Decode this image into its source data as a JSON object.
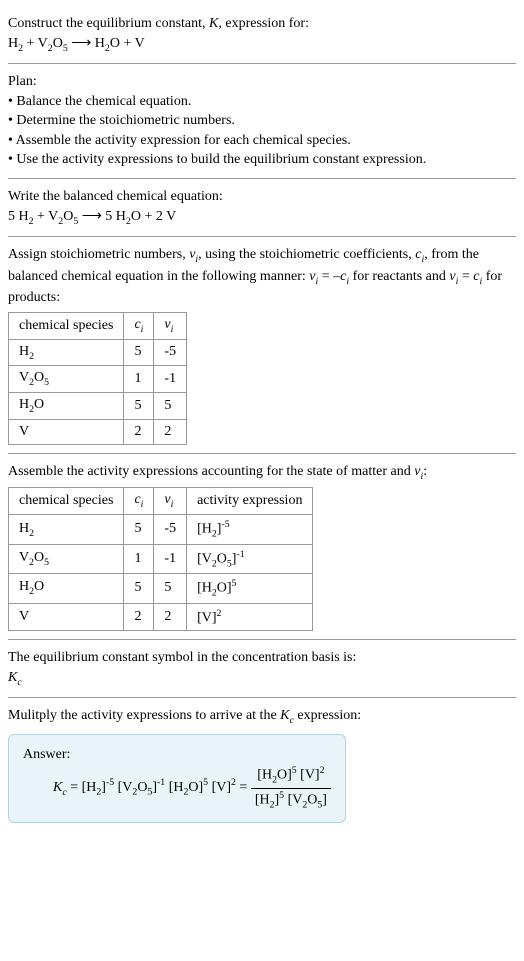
{
  "title": "Construct the equilibrium constant, K, expression for:",
  "equation_unbalanced": "H₂ + V₂O₅ ⟶ H₂O + V",
  "plan_heading": "Plan:",
  "plan_items": [
    "• Balance the chemical equation.",
    "• Determine the stoichiometric numbers.",
    "• Assemble the activity expression for each chemical species.",
    "• Use the activity expressions to build the equilibrium constant expression."
  ],
  "balanced_heading": "Write the balanced chemical equation:",
  "equation_balanced": "5 H₂ + V₂O₅ ⟶ 5 H₂O + 2 V",
  "stoich_intro_1": "Assign stoichiometric numbers, νᵢ, using the stoichiometric coefficients, cᵢ, from the balanced chemical equation in the following manner: νᵢ = –cᵢ for reactants and νᵢ = cᵢ for products:",
  "table1": {
    "headers": [
      "chemical species",
      "cᵢ",
      "νᵢ"
    ],
    "rows": [
      [
        "H₂",
        "5",
        "-5"
      ],
      [
        "V₂O₅",
        "1",
        "-1"
      ],
      [
        "H₂O",
        "5",
        "5"
      ],
      [
        "V",
        "2",
        "2"
      ]
    ]
  },
  "activity_heading": "Assemble the activity expressions accounting for the state of matter and νᵢ:",
  "table2": {
    "headers": [
      "chemical species",
      "cᵢ",
      "νᵢ",
      "activity expression"
    ],
    "rows": [
      {
        "species": "H₂",
        "ci": "5",
        "vi": "-5",
        "expr": "[H₂]⁻⁵"
      },
      {
        "species": "V₂O₅",
        "ci": "1",
        "vi": "-1",
        "expr": "[V₂O₅]⁻¹"
      },
      {
        "species": "H₂O",
        "ci": "5",
        "vi": "5",
        "expr": "[H₂O]⁵"
      },
      {
        "species": "V",
        "ci": "2",
        "vi": "2",
        "expr": "[V]²"
      }
    ]
  },
  "kc_symbol_heading": "The equilibrium constant symbol in the concentration basis is:",
  "kc_symbol": "K_c",
  "multiply_heading": "Mulitply the activity expressions to arrive at the K_c expression:",
  "answer_label": "Answer:",
  "answer_equation": {
    "lhs": "K_c = [H₂]⁻⁵ [V₂O₅]⁻¹ [H₂O]⁵ [V]² = ",
    "numerator": "[H₂O]⁵ [V]²",
    "denominator": "[H₂]⁵ [V₂O₅]"
  }
}
